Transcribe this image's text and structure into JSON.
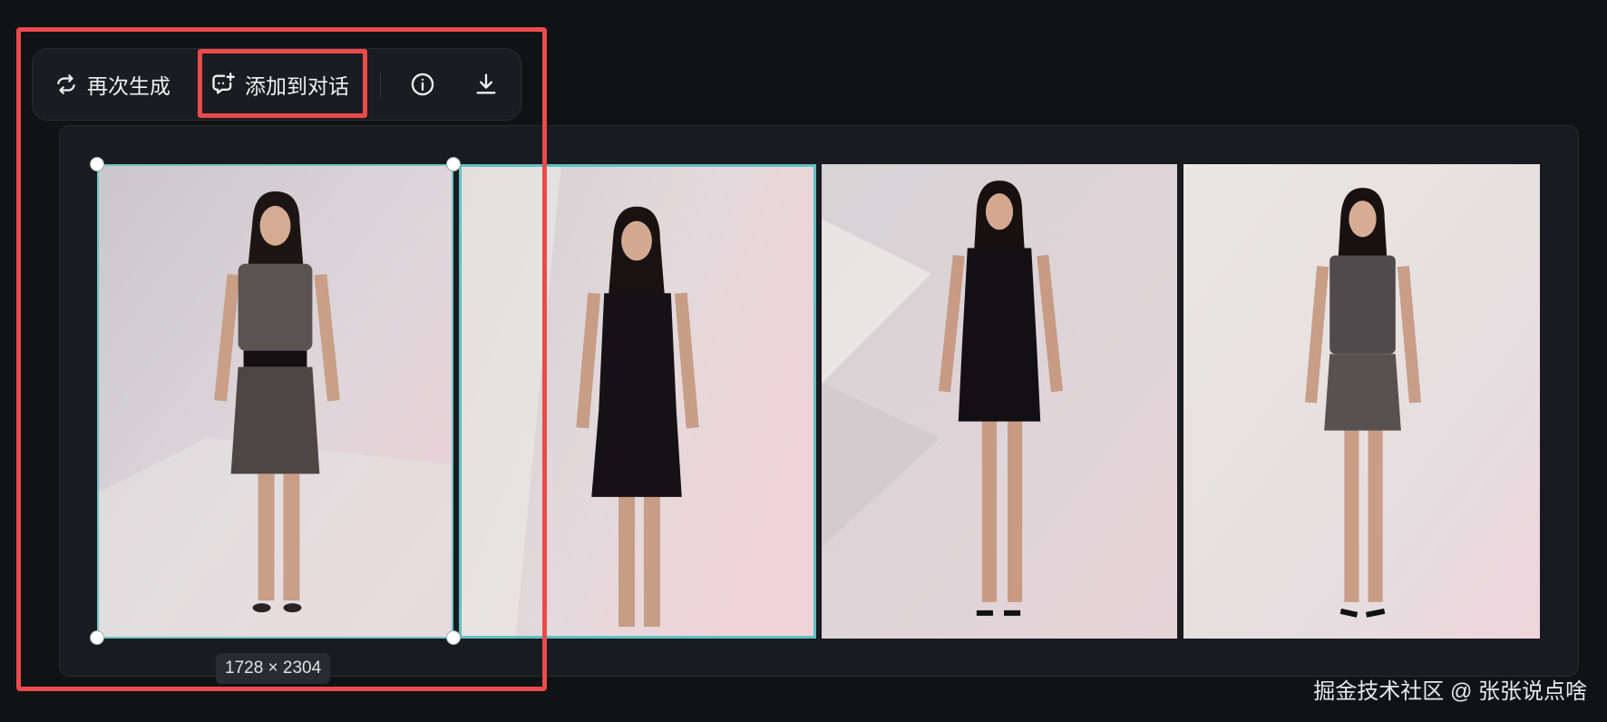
{
  "toolbar": {
    "regenerate_label": "再次生成",
    "add_to_chat_label": "添加到对话",
    "info_icon": "info-icon",
    "download_icon": "download-icon"
  },
  "gallery": {
    "image_count": 4,
    "selected_index": 0,
    "selected_dimensions": "1728 × 2304"
  },
  "watermark": "掘金技术社区 @ 张张说点啥",
  "colors": {
    "background": "#111216",
    "panel": "#1a1b20",
    "selection": "#5fc1c1",
    "annotation": "#ea4b4b"
  }
}
